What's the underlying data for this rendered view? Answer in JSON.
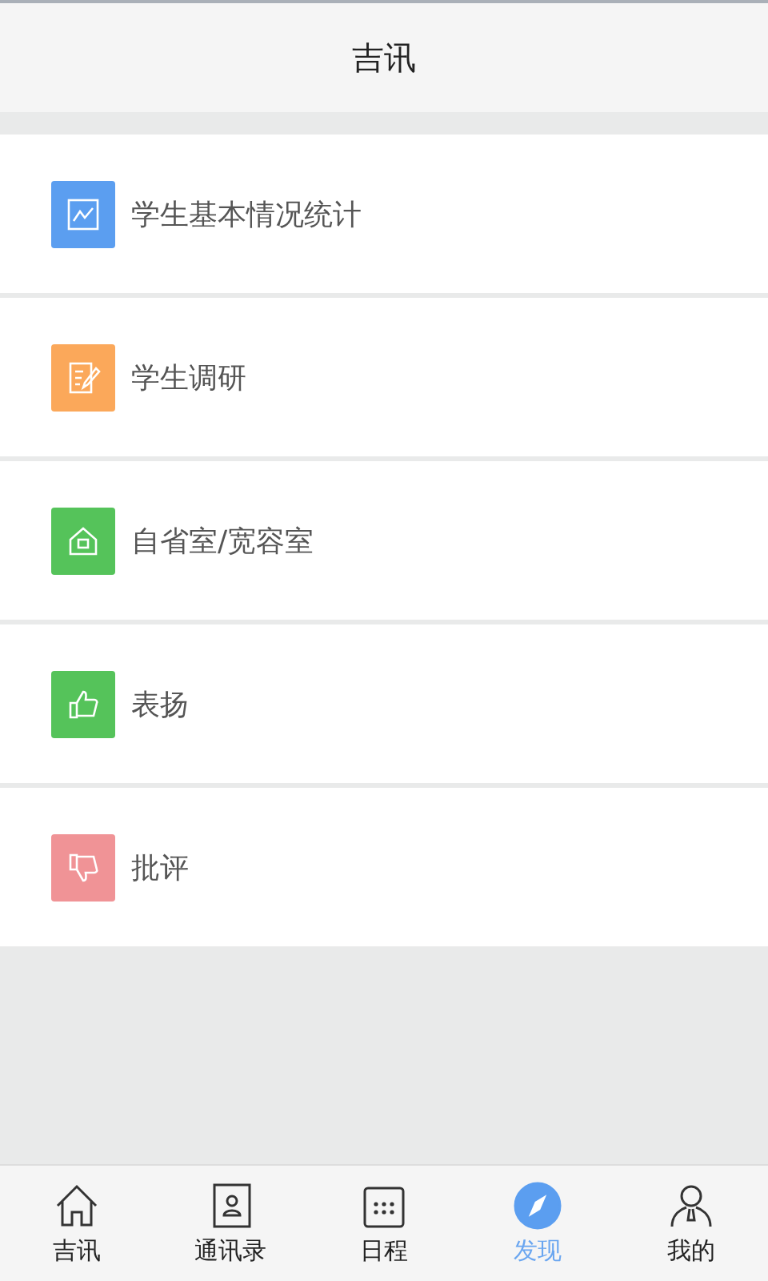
{
  "header": {
    "title": "吉讯"
  },
  "menu": [
    {
      "label": "学生基本情况统计",
      "kind": "chart",
      "color": "#5b9ef0"
    },
    {
      "label": "学生调研",
      "kind": "survey",
      "color": "#fba85a"
    },
    {
      "label": "自省室/宽容室",
      "kind": "house",
      "color": "#55c35a"
    },
    {
      "label": "表扬",
      "kind": "thumbs-up",
      "color": "#55c35a"
    },
    {
      "label": "批评",
      "kind": "thumbs-down",
      "color": "#f09396"
    }
  ],
  "tabs": [
    {
      "label": "吉讯",
      "kind": "home",
      "selected": false
    },
    {
      "label": "通讯录",
      "kind": "contacts",
      "selected": false
    },
    {
      "label": "日程",
      "kind": "calendar",
      "selected": false
    },
    {
      "label": "发现",
      "kind": "compass",
      "selected": true
    },
    {
      "label": "我的",
      "kind": "person",
      "selected": false
    }
  ]
}
